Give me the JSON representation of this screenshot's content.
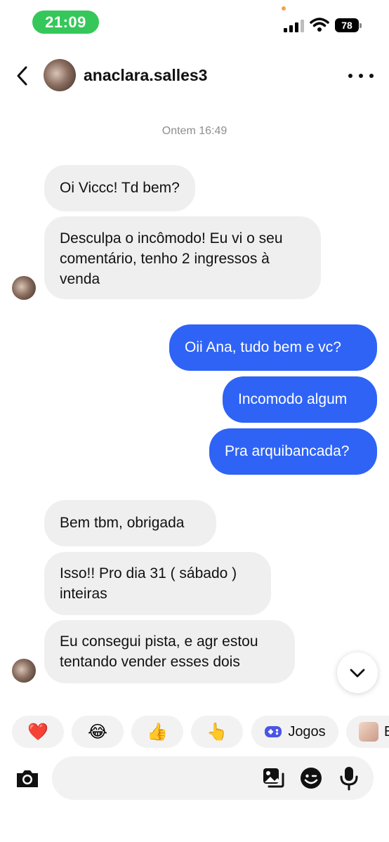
{
  "status_bar": {
    "time": "21:09",
    "battery": "78"
  },
  "header": {
    "username": "anaclara.salles3"
  },
  "timestamp": "Ontem 16:49",
  "messages": [
    {
      "from": "them",
      "lines": [
        "Oi Viccc! Td bem?"
      ]
    },
    {
      "from": "them",
      "lines": [
        "Desculpa o incômodo! Eu vi o seu",
        "comentário, tenho 2 ingressos à",
        "venda"
      ]
    },
    {
      "from": "me",
      "lines": [
        "Oii Ana, tudo bem e vc?"
      ]
    },
    {
      "from": "me",
      "lines": [
        "Incomodo algum"
      ]
    },
    {
      "from": "me",
      "lines": [
        "Pra arquibancada?"
      ]
    },
    {
      "from": "them",
      "lines": [
        "Bem tbm, obrigada"
      ]
    },
    {
      "from": "them",
      "lines": [
        "Isso!! Pro dia 31 ( sábado )",
        "inteiras"
      ]
    },
    {
      "from": "them",
      "lines": [
        "Eu consegui pista, e agr estou",
        "tentando vender esses dois"
      ]
    }
  ],
  "quick_replies": [
    {
      "emoji": "❤️"
    },
    {
      "emoji": "😂"
    },
    {
      "emoji": "👍"
    },
    {
      "emoji": "👆"
    },
    {
      "icon": "games-icon",
      "label": "Jogos"
    },
    {
      "icon": "sticker-thumbnail",
      "label": "E"
    }
  ],
  "colors": {
    "outgoing": "#2e63f6",
    "incoming": "#efefef",
    "time_pill": "#35c759"
  },
  "icons": [
    "back-icon",
    "more-icon",
    "chevron-down-icon",
    "camera-icon",
    "gallery-icon",
    "sticker-icon",
    "microphone-icon"
  ]
}
